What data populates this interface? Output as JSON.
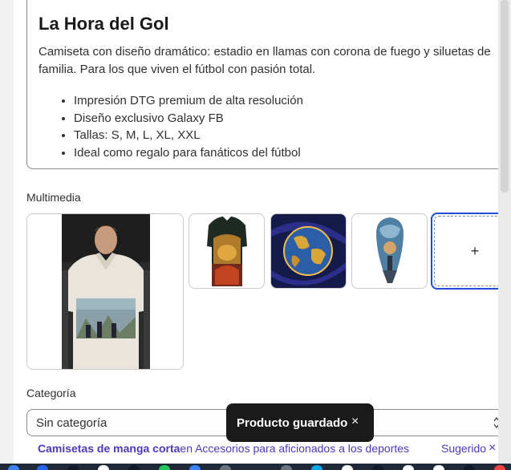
{
  "description": {
    "title": "La Hora del Gol",
    "paragraph": "Camiseta con diseño dramático: estadio en llamas con corona de fuego y siluetas de familia. Para los que viven el fútbol con pasión total.",
    "bullets": [
      "Impresión DTG premium de alta resolución",
      "Diseño exclusivo Galaxy FB",
      "Tallas: S, M, L, XL, XXL",
      "Ideal como regalo para fanáticos del fútbol"
    ]
  },
  "media": {
    "label": "Multimedia",
    "add_label": "+",
    "items": [
      {
        "name": "polo-model-image"
      },
      {
        "name": "fire-shirt-image"
      },
      {
        "name": "golden-ball-image"
      },
      {
        "name": "family-silhouette-image"
      }
    ]
  },
  "category": {
    "label": "Categoría",
    "value": "Sin categoría",
    "suggestion_strong": "Camisetas de manga corta",
    "suggestion_rest": "en Accesorios para aficionados a los deportes",
    "suggestion_tag": "Sugerido",
    "dismiss_icon": "×"
  },
  "toast": {
    "message": "Producto guardado",
    "close_icon": "×"
  },
  "colors": {
    "accent": "#1d4ed8",
    "suggestion": "#4b3ab8",
    "toast_bg": "#1a1a1a"
  }
}
